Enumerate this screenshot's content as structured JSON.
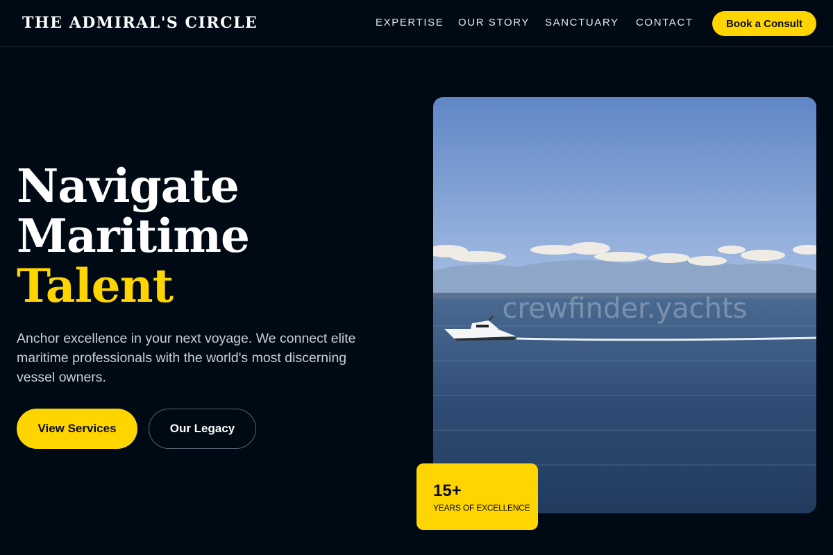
{
  "header": {
    "brand": "THE ADMIRAL'S CIRCLE",
    "nav": [
      "EXPERTISE",
      "OUR STORY",
      "SANCTUARY",
      "CONTACT"
    ],
    "cta": "Book a Consult"
  },
  "hero": {
    "headline_line1": "Navigate",
    "headline_line2": "Maritime",
    "headline_accent": "Talent",
    "lede": "Anchor excellence in your next voyage. We connect elite maritime professionals with the world's most discerning vessel owners.",
    "primary_button": "View Services",
    "secondary_button": "Our Legacy"
  },
  "photo": {
    "watermark": "crewfinder.yachts"
  },
  "badge": {
    "number": "15+",
    "label": "YEARS OF EXCELLENCE"
  },
  "colors": {
    "background": "#000a14",
    "accent": "#ffd500",
    "text": "#ffffff"
  }
}
